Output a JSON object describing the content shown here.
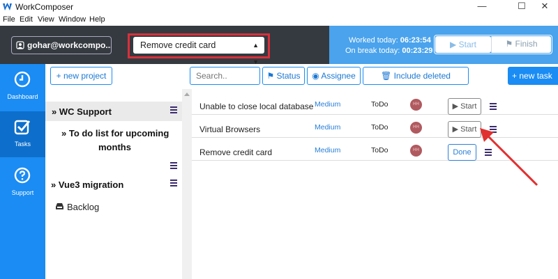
{
  "window": {
    "title": "WorkComposer",
    "minimize": "—",
    "maximize": "☐",
    "close": "✕"
  },
  "menu": [
    "File",
    "Edit",
    "View",
    "Window",
    "Help"
  ],
  "header": {
    "user": "gohar@workcompo...",
    "selected_task": "Remove credit card",
    "worked_label": "Worked today: ",
    "worked_time": "06:23:54",
    "break_label": "On break today: ",
    "break_time": "00:23:29",
    "start_label": "▶ Start",
    "finish_label": "⚑ Finish"
  },
  "sidebar": {
    "items": [
      {
        "label": "Dashboard",
        "icon": "clock-icon"
      },
      {
        "label": "Tasks",
        "icon": "checkbox-icon"
      },
      {
        "label": "Support",
        "icon": "question-icon"
      }
    ]
  },
  "toolbar": {
    "new_project": "+ new project",
    "search_placeholder": "Search..",
    "status": "⚑ Status",
    "assignee": "Assignee",
    "include_deleted": "Include deleted",
    "new_task": "+ new task"
  },
  "projects": {
    "items": [
      {
        "label": "» WC Support"
      },
      {
        "label": "» To do list for upcoming"
      },
      {
        "label": "months"
      },
      {
        "label": "» Vue3 migration"
      }
    ],
    "backlog": "Backlog"
  },
  "tasks": [
    {
      "name": "Unable to close local database",
      "priority": "Medium",
      "status": "ToDo",
      "avatar": "HH",
      "action": "▶ Start"
    },
    {
      "name": "Virtual Browsers",
      "priority": "Medium",
      "status": "ToDo",
      "avatar": "HH",
      "action": "▶ Start"
    },
    {
      "name": "Remove credit card",
      "priority": "Medium",
      "status": "ToDo",
      "avatar": "HH",
      "action": "Done"
    }
  ],
  "colors": {
    "header_dark": "#353a40",
    "header_blue": "#4aa3ec",
    "sidebar": "#1a8cf4",
    "highlight": "#d9303a"
  }
}
